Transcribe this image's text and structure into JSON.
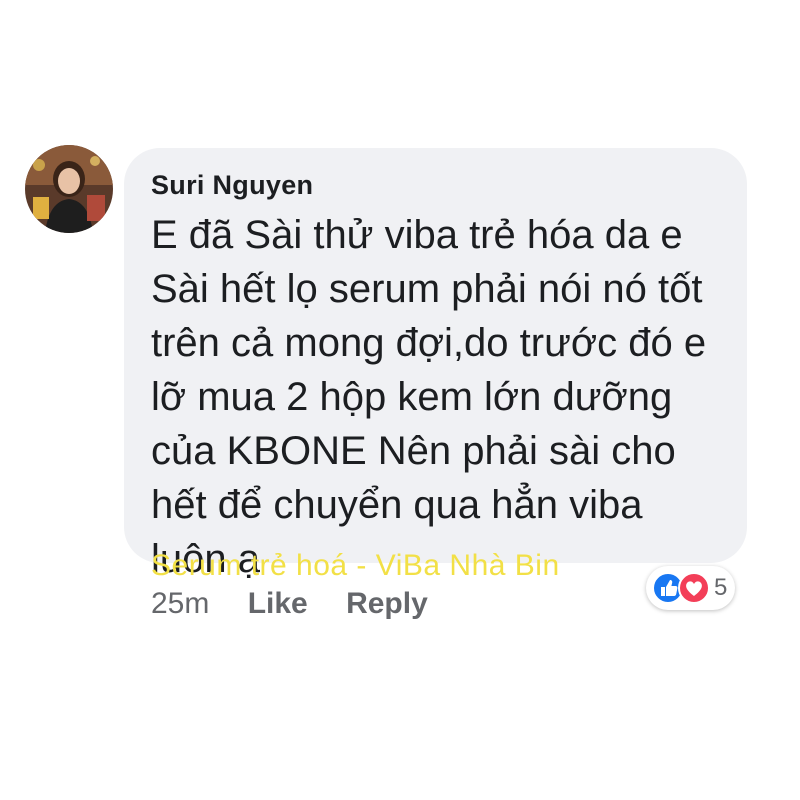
{
  "comment": {
    "author": "Suri Nguyen",
    "lines": [
      "E đã Sài thử viba trẻ hóa da e",
      "Sài hết lọ serum phải nói nó tốt",
      "trên cả mong đợi,do trước đó e",
      "lỡ mua 2 hộp kem  lớn dưỡng",
      "của KBONE Nên phải sài cho",
      "hết để chuyển qua hẳn viba",
      "luôn ạ"
    ],
    "watermark": "Serum trẻ hoá - ViBa Nhà Bin",
    "timestamp": "25m",
    "like_label": "Like",
    "reply_label": "Reply",
    "reactions": {
      "icons": [
        "like-icon",
        "love-icon"
      ],
      "count": "5",
      "colors": {
        "like": "#1877f2",
        "love": "#f33e58"
      }
    }
  },
  "colors": {
    "bubble": "#f0f1f4",
    "text": "#1c1e21",
    "meta": "#65676b",
    "watermark": "#f2e046"
  }
}
